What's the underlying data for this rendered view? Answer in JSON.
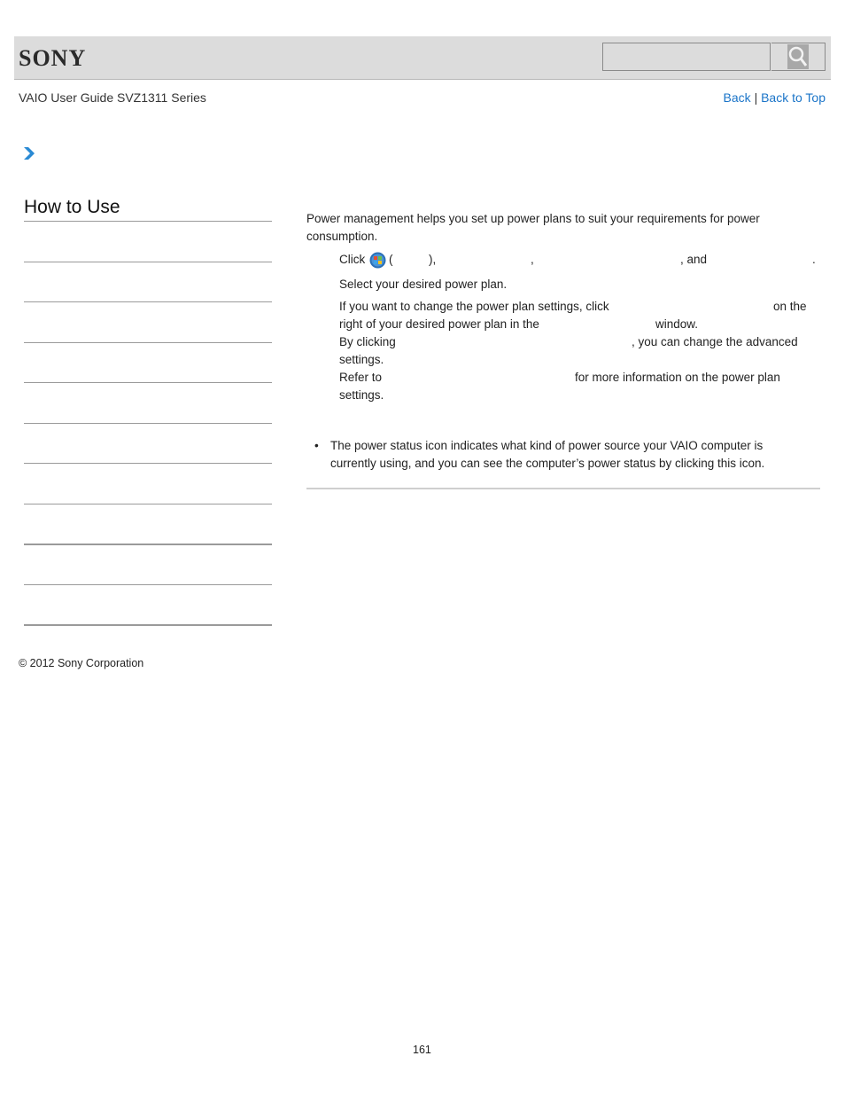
{
  "header": {
    "logo": "SONY",
    "search": {
      "placeholder": "",
      "value": ""
    },
    "search_icon": "magnifier-icon"
  },
  "guide_title": "VAIO User Guide SVZ1311 Series",
  "nav_links": {
    "back": "Back",
    "separator": "|",
    "back_to_top": "Back to Top"
  },
  "breadcrumb_icon": "chevron-right-icon",
  "sidebar": {
    "title": "How to Use",
    "items": [
      "",
      "",
      "",
      "",
      "",
      "",
      "",
      "",
      "",
      ""
    ]
  },
  "content": {
    "intro": "Power management helps you set up power plans to suit your requirements for power consumption.",
    "steps": {
      "step1": {
        "click": "Click",
        "open_paren": "(",
        "close_paren": "),",
        "comma": ",",
        "and": ", and",
        "period": "."
      },
      "step2": "Select your desired power plan.",
      "step3_line1_a": "If you want to change the power plan settings, click",
      "step3_line1_b": "on the",
      "step3_line2_a": "right of your desired power plan in the",
      "step3_line2_b": "window.",
      "step3_line3_a": "By clicking",
      "step3_line3_b": ", you can change the advanced",
      "step3_line4": "settings.",
      "step3_line5_a": "Refer to",
      "step3_line5_b": "for more information on the power plan",
      "step3_line6": "settings."
    },
    "note_bullet": "•",
    "note": "The power status icon indicates what kind of power source your VAIO computer is currently using, and you can see the computer’s power status by clicking this icon."
  },
  "footer": {
    "copyright": "© 2012 Sony Corporation",
    "page_number": "161"
  },
  "colors": {
    "link": "#1a74c8",
    "header_bg": "#dcdcdc",
    "chevron": "#2a8ad4"
  }
}
